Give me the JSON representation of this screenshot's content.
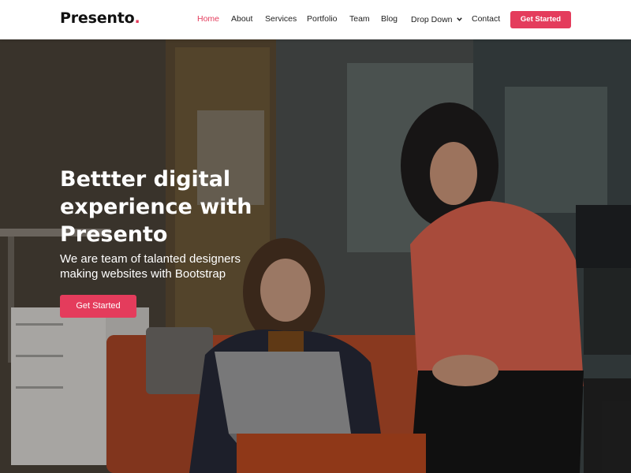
{
  "brand": {
    "name": "Presento",
    "dot": ".",
    "accent_color": "#e43c5c"
  },
  "nav": {
    "items": [
      {
        "label": "Home",
        "active": true
      },
      {
        "label": "About"
      },
      {
        "label": "Services"
      },
      {
        "label": "Portfolio"
      },
      {
        "label": "Team"
      },
      {
        "label": "Blog"
      },
      {
        "label": "Drop Down",
        "icon": "chevron-down-icon"
      },
      {
        "label": "Contact"
      }
    ],
    "cta_label": "Get Started"
  },
  "hero": {
    "title_lines": [
      "Bettter digital",
      "experience with",
      "Presento"
    ],
    "subtitle_lines": [
      "We are team of talanted designers",
      "making websites with Bootstrap"
    ],
    "cta_label": "Get Started",
    "background": "office-photo"
  }
}
